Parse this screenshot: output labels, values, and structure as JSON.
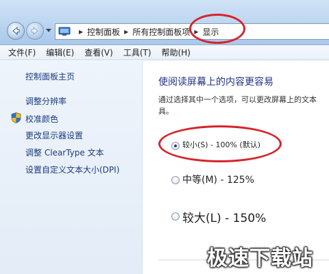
{
  "address_bar": {
    "breadcrumbs": [
      "控制面板",
      "所有控制面板项",
      "显示"
    ]
  },
  "menu": [
    "文件(F)",
    "编辑(E)",
    "查看(V)",
    "工具(T)",
    "帮助(H)"
  ],
  "sidebar": {
    "items": [
      {
        "label": "控制面板主页"
      },
      {
        "label": "调整分辨率"
      },
      {
        "label": "校准颜色"
      },
      {
        "label": "更改显示器设置"
      },
      {
        "label": "调整 ClearType 文本"
      },
      {
        "label": "设置自定义文本大小(DPI)"
      }
    ]
  },
  "main": {
    "title": "使阅读屏幕上的内容更容易",
    "description_line1": "通过选择其中一个选项，可以更改屏幕上的文本",
    "description_line2": "具。",
    "options": [
      {
        "label": "较小(S) - 100% (默认)",
        "selected": true
      },
      {
        "label": "中等(M) - 125%",
        "selected": false
      },
      {
        "label": "较大(L) - 150%",
        "selected": false
      }
    ]
  },
  "watermark": "极速下载站",
  "colors": {
    "annotation_red": "#d8232a",
    "link_blue": "#1a3a80",
    "title_blue": "#1e3287"
  }
}
